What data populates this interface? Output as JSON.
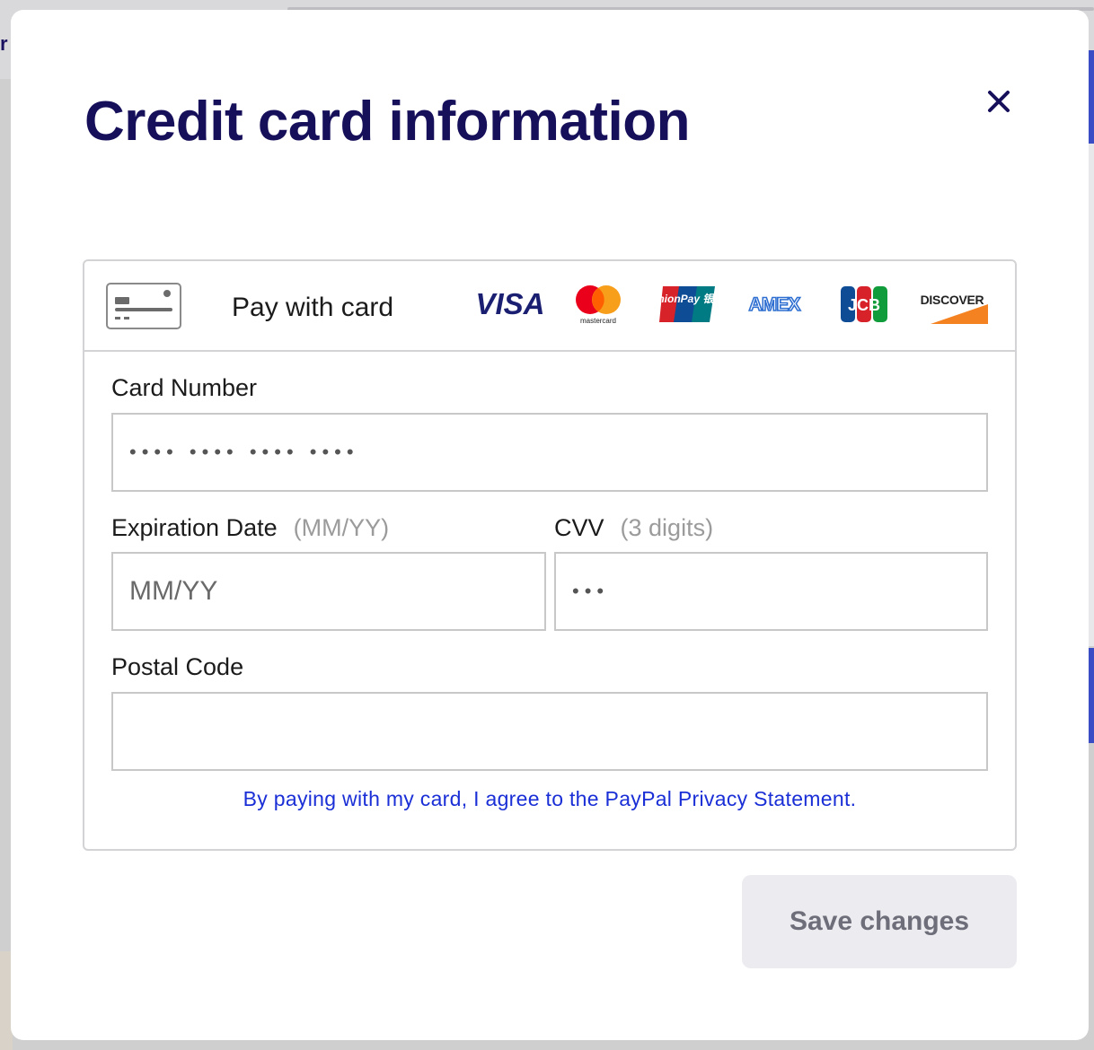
{
  "modal": {
    "title": "Credit card information",
    "close_icon": "close-icon"
  },
  "card_panel": {
    "pay_label": "Pay with card",
    "brands": [
      "VISA",
      "mastercard",
      "UnionPay 银联",
      "AMEX",
      "JCB",
      "DISCOVER"
    ]
  },
  "fields": {
    "card_number": {
      "label": "Card Number",
      "placeholder": "•••• •••• •••• ••••"
    },
    "expiration": {
      "label": "Expiration Date",
      "hint": "(MM/YY)",
      "placeholder": "MM/YY"
    },
    "cvv": {
      "label": "CVV",
      "hint": "(3 digits)",
      "placeholder": "•••"
    },
    "postal": {
      "label": "Postal Code",
      "value": ""
    }
  },
  "privacy_text": "By paying with my card, I agree to the PayPal Privacy Statement.",
  "save_label": "Save changes",
  "colors": {
    "title": "#160f5a",
    "link": "#1a2fd6",
    "button_bg": "#ececf0",
    "button_text": "#6e6e7a"
  }
}
